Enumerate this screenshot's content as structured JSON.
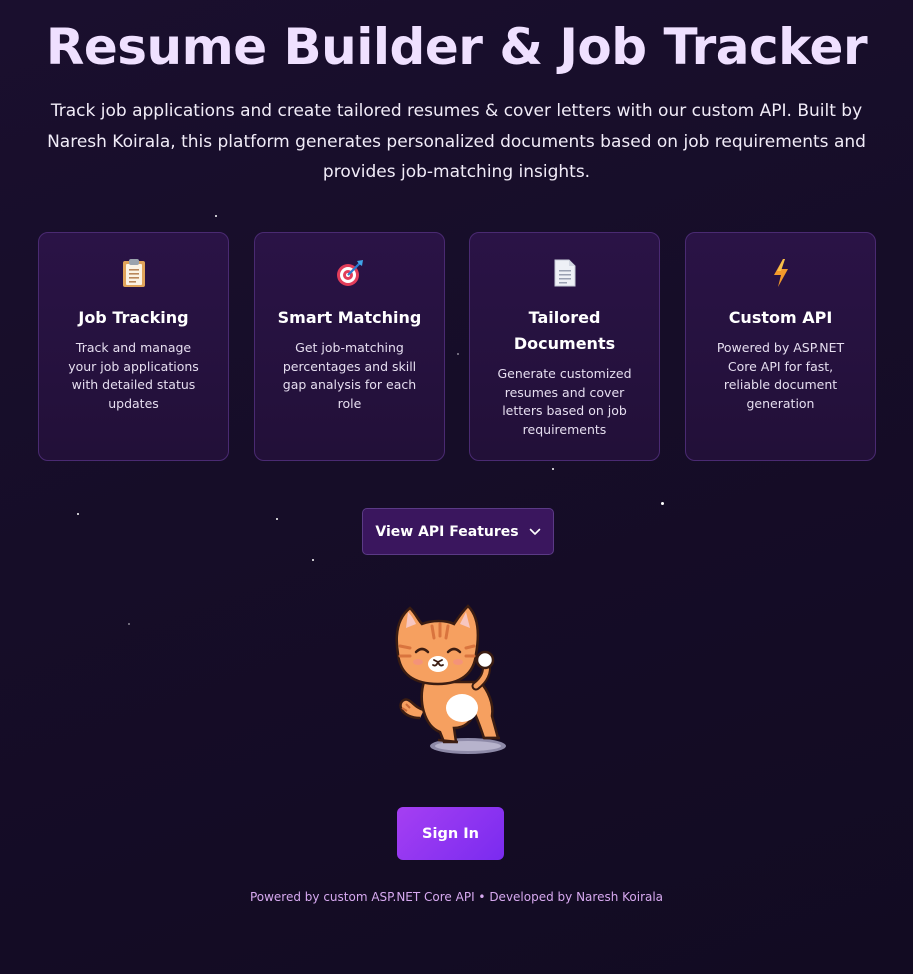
{
  "header": {
    "title": "Resume Builder & Job Tracker",
    "subtitle": "Track job applications and create tailored resumes & cover letters with our custom API. Built by Naresh Koirala, this platform generates personalized documents based on job requirements and provides job-matching insights."
  },
  "features": [
    {
      "icon": "clipboard-icon",
      "title": "Job Tracking",
      "description": "Track and manage your job applications with detailed status updates"
    },
    {
      "icon": "target-icon",
      "title": "Smart Matching",
      "description": "Get job-matching percentages and skill gap analysis for each role"
    },
    {
      "icon": "document-icon",
      "title": "Tailored Documents",
      "description": "Generate customized resumes and cover letters based on job requirements"
    },
    {
      "icon": "lightning-icon",
      "title": "Custom API",
      "description": "Powered by ASP.NET Core API for fast, reliable document generation"
    }
  ],
  "api_button": {
    "label": "View API Features",
    "icon": "chevron-down-icon"
  },
  "mascot": {
    "icon": "waving-cat-illustration"
  },
  "signin_button": {
    "label": "Sign In"
  },
  "footer": {
    "text": "Powered by custom ASP.NET Core API • Developed by Naresh Koirala"
  },
  "colors": {
    "background": "#160d28",
    "card_background": "#251040",
    "card_border": "#4a2a72",
    "title": "#efe0ff",
    "api_button": "#3a165e",
    "signin_button": "#8f35f1",
    "footer_text": "#d7a9f0"
  }
}
